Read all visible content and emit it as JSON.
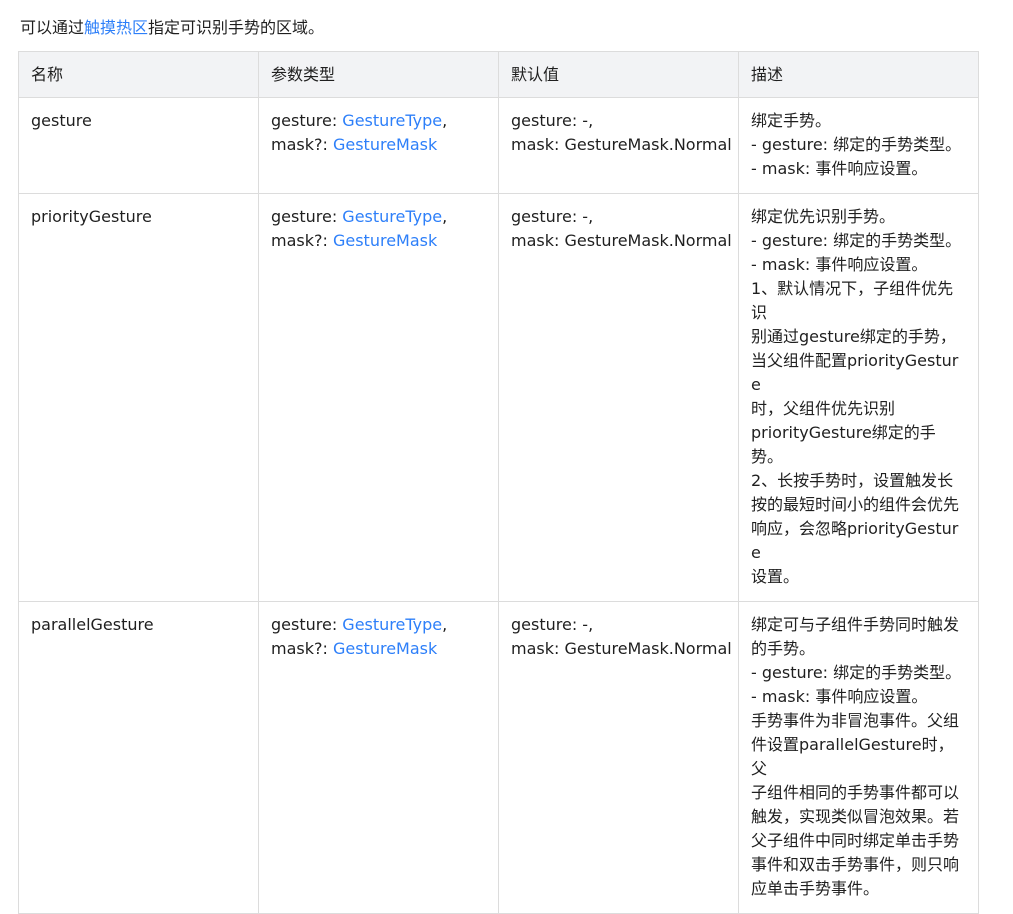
{
  "intro": {
    "before": "可以通过",
    "link": "触摸热区",
    "after": "指定可识别手势的区域。"
  },
  "table": {
    "headers": [
      "名称",
      "参数类型",
      "默认值",
      "描述"
    ],
    "rows": [
      {
        "name": "gesture",
        "param_line1_prefix": "gesture: ",
        "param_line1_link": "GestureType",
        "param_line1_suffix": ",",
        "param_line2_prefix": "mask?: ",
        "param_line2_link": "GestureMask",
        "default_line1": "gesture: -,",
        "default_line2": "mask: GestureMask.Normal",
        "description": [
          "绑定手势。",
          "- gesture: 绑定的手势类型。",
          "- mask: 事件响应设置。"
        ]
      },
      {
        "name": "priorityGesture",
        "param_line1_prefix": "gesture: ",
        "param_line1_link": "GestureType",
        "param_line1_suffix": ",",
        "param_line2_prefix": "mask?: ",
        "param_line2_link": "GestureMask",
        "default_line1": "gesture: -,",
        "default_line2": "mask: GestureMask.Normal",
        "description": [
          "绑定优先识别手势。",
          "- gesture: 绑定的手势类型。",
          "- mask: 事件响应设置。",
          "1、默认情况下，子组件优先识",
          "别通过gesture绑定的手势，",
          "当父组件配置priorityGesture",
          "时，父组件优先识别",
          "priorityGesture绑定的手势。",
          "2、长按手势时，设置触发长",
          "按的最短时间小的组件会优先",
          "响应，会忽略priorityGesture",
          "设置。"
        ]
      },
      {
        "name": "parallelGesture",
        "param_line1_prefix": "gesture: ",
        "param_line1_link": "GestureType",
        "param_line1_suffix": ",",
        "param_line2_prefix": "mask?: ",
        "param_line2_link": "GestureMask",
        "default_line1": "gesture: -,",
        "default_line2": "mask: GestureMask.Normal",
        "description": [
          "绑定可与子组件手势同时触发",
          "的手势。",
          "- gesture: 绑定的手势类型。",
          "- mask: 事件响应设置。",
          "手势事件为非冒泡事件。父组",
          "件设置parallelGesture时，父",
          "子组件相同的手势事件都可以",
          "触发，实现类似冒泡效果。若",
          "父子组件中同时绑定单击手势",
          "事件和双击手势事件，则只响",
          "应单击手势事件。"
        ]
      }
    ]
  },
  "colors": {
    "link": "#2d7ff9",
    "header_bg": "#f2f3f5",
    "border": "#dcdcdc",
    "text": "#1f1f1f"
  }
}
